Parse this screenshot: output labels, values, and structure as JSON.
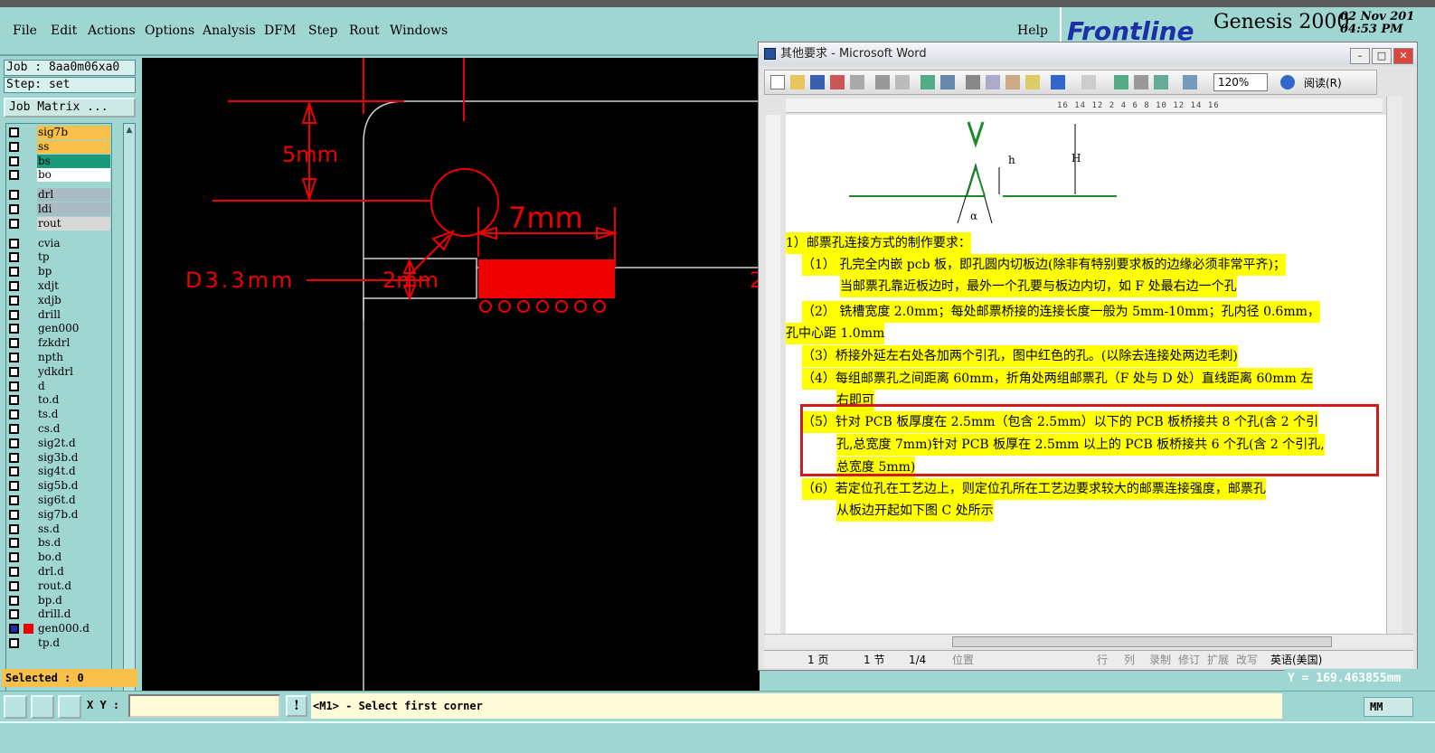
{
  "menubar": {
    "items": [
      "File",
      "Edit",
      "Actions",
      "Options",
      "Analysis",
      "DFM",
      "Step",
      "Rout",
      "Windows"
    ],
    "help": "Help"
  },
  "brand": {
    "logo": "Frontline",
    "product": "Genesis 2000",
    "date": "02 Nov 201",
    "time": "04:53 PM"
  },
  "job": {
    "job_line": "Job : 8aa0m06xa0",
    "step_line": "Step: set",
    "matrix_button": "Job Matrix ..."
  },
  "layers": [
    {
      "name": "sig7b",
      "color": "#f6c04a"
    },
    {
      "name": "ss",
      "color": "#f6c04a"
    },
    {
      "name": "bs",
      "color": "#1a9a7a"
    },
    {
      "name": "bo",
      "color": "#ffffff"
    },
    {
      "name": "drl",
      "color": "#a9bcc4"
    },
    {
      "name": "ldi",
      "color": "#a9bcc4"
    },
    {
      "name": "rout",
      "color": "#d8d8d8"
    },
    {
      "name": "cvia",
      "color": "#9fd6d2"
    },
    {
      "name": "tp",
      "color": "#9fd6d2"
    },
    {
      "name": "bp",
      "color": "#9fd6d2"
    },
    {
      "name": "xdjt",
      "color": "#9fd6d2"
    },
    {
      "name": "xdjb",
      "color": "#9fd6d2"
    },
    {
      "name": "drill",
      "color": "#9fd6d2"
    },
    {
      "name": "gen000",
      "color": "#9fd6d2"
    },
    {
      "name": "fzkdrl",
      "color": "#9fd6d2"
    },
    {
      "name": "npth",
      "color": "#9fd6d2"
    },
    {
      "name": "ydkdrl",
      "color": "#9fd6d2"
    },
    {
      "name": "d",
      "color": "#9fd6d2"
    },
    {
      "name": "to.d",
      "color": "#9fd6d2"
    },
    {
      "name": "ts.d",
      "color": "#9fd6d2"
    },
    {
      "name": "cs.d",
      "color": "#9fd6d2"
    },
    {
      "name": "sig2t.d",
      "color": "#9fd6d2"
    },
    {
      "name": "sig3b.d",
      "color": "#9fd6d2"
    },
    {
      "name": "sig4t.d",
      "color": "#9fd6d2"
    },
    {
      "name": "sig5b.d",
      "color": "#9fd6d2"
    },
    {
      "name": "sig6t.d",
      "color": "#9fd6d2"
    },
    {
      "name": "sig7b.d",
      "color": "#9fd6d2"
    },
    {
      "name": "ss.d",
      "color": "#9fd6d2"
    },
    {
      "name": "bs.d",
      "color": "#9fd6d2"
    },
    {
      "name": "bo.d",
      "color": "#9fd6d2"
    },
    {
      "name": "drl.d",
      "color": "#9fd6d2"
    },
    {
      "name": "rout.d",
      "color": "#9fd6d2"
    },
    {
      "name": "bp.d",
      "color": "#9fd6d2"
    },
    {
      "name": "drill.d",
      "color": "#9fd6d2"
    },
    {
      "name": "gen000.d",
      "color": "#9fd6d2"
    },
    {
      "name": "tp.d",
      "color": "#9fd6d2"
    }
  ],
  "selected_label": "Selected : 0",
  "canvas": {
    "dim_5mm": "5mm",
    "dim_7mm": "7mm",
    "dim_d33": "D3.3mm",
    "dim_2mm": "2mm",
    "edge_mark": "2"
  },
  "word": {
    "title": "其他要求 - Microsoft Word",
    "zoom": "120%",
    "read_mode": "阅读(R)",
    "ruler": "16 14 12 2 4 6 8 10 12 14 16",
    "figure_labels": {
      "h": "h",
      "H": "H",
      "alpha": "α"
    },
    "paragraphs": [
      "1）邮票孔连接方式的制作要求：",
      "（1） 孔完全内嵌 pcb 板，即孔圆内切板边(除非有特别要求板的边缘必须非常平齐)；",
      "当邮票孔靠近板边时，最外一个孔要与板边内切，如 F 处最右边一个孔",
      "（2） 铣槽宽度 2.0mm；每处邮票桥接的连接长度一般为 5mm-10mm；孔内径 0.6mm，",
      "孔中心距 1.0mm",
      "（3）桥接外延左右处各加两个引孔，图中红色的孔。(以除去连接处两边毛刺)",
      "（4）每组邮票孔之间距离 60mm，折角处两组邮票孔（F 处与 D 处）直线距离 60mm 左",
      "右即可",
      "（5）针对 PCB 板厚度在 2.5mm（包含 2.5mm）以下的 PCB 板桥接共 8 个孔(含 2 个引",
      "孔,总宽度 7mm)针对 PCB 板厚在 2.5mm 以上的 PCB 板桥接共 6 个孔(含 2 个引孔,",
      "总宽度 5mm)",
      "（6）若定位孔在工艺边上，则定位孔所在工艺边要求较大的邮票连接强度，邮票孔",
      "从板边开起如下图 C 处所示"
    ],
    "status": {
      "page": "1 页",
      "section": "1 节",
      "pages": "1/4",
      "position": "位置",
      "row": "行",
      "col": "列",
      "rec": "录制",
      "trk": "修订",
      "ext": "扩展",
      "ovr": "改写",
      "lang": "英语(美国)"
    }
  },
  "bottom": {
    "xy_label": "X Y :",
    "xy_value": "",
    "message": "<M1> - Select first corner",
    "coord_y": "Y = 169.463855mm",
    "units": "MM"
  }
}
